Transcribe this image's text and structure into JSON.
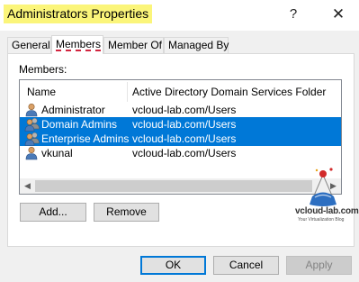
{
  "window": {
    "title": "Administrators Properties",
    "help_glyph": "?",
    "close_glyph": "✕"
  },
  "tabs": [
    {
      "label": "General"
    },
    {
      "label": "Members",
      "active": true
    },
    {
      "label": "Member Of"
    },
    {
      "label": "Managed By"
    }
  ],
  "members": {
    "label": "Members:",
    "columns": {
      "name": "Name",
      "folder": "Active Directory Domain Services Folder"
    },
    "rows": [
      {
        "name": "Administrator",
        "folder": "vcloud-lab.com/Users",
        "icon": "user-icon",
        "selected": false
      },
      {
        "name": "Domain Admins",
        "folder": "vcloud-lab.com/Users",
        "icon": "group-icon",
        "selected": true
      },
      {
        "name": "Enterprise Admins",
        "folder": "vcloud-lab.com/Users",
        "icon": "group-icon",
        "selected": true
      },
      {
        "name": "vkunal",
        "folder": "vcloud-lab.com/Users",
        "icon": "user-icon",
        "selected": false
      }
    ],
    "scroll_left": "◀",
    "scroll_right": "▶"
  },
  "actions": {
    "add": "Add...",
    "remove": "Remove"
  },
  "footer": {
    "ok": "OK",
    "cancel": "Cancel",
    "apply": "Apply"
  },
  "watermark": {
    "text": "vcloud-lab.com",
    "subtitle": "Your Virtualization Blog"
  },
  "colors": {
    "selection": "#0078d7",
    "title_highlight": "#fbf57a",
    "underline": "#d2253f"
  }
}
